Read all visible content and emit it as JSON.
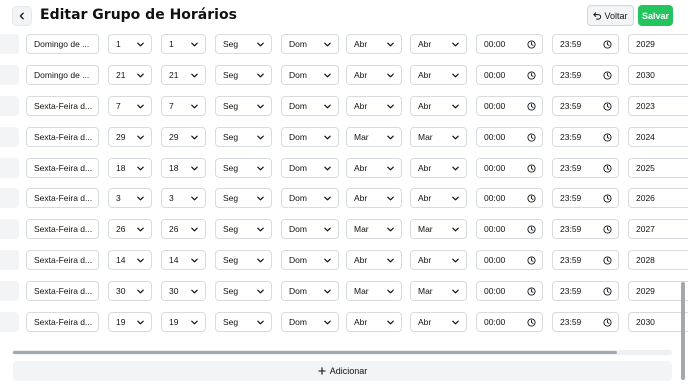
{
  "header": {
    "title": "Editar Grupo de Horários",
    "voltar_label": "Voltar",
    "salvar_label": "Salvar",
    "salvar_color": "#22c55e"
  },
  "rows": [
    {
      "name": "Domingo de ...",
      "day_start": "1",
      "day_end": "1",
      "weekday_start": "Seg",
      "weekday_end": "Dom",
      "month_start": "Abr",
      "month_end": "Abr",
      "time_start": "00:00",
      "time_end": "23:59",
      "year": "2029"
    },
    {
      "name": "Domingo de ...",
      "day_start": "21",
      "day_end": "21",
      "weekday_start": "Seg",
      "weekday_end": "Dom",
      "month_start": "Abr",
      "month_end": "Abr",
      "time_start": "00:00",
      "time_end": "23:59",
      "year": "2030"
    },
    {
      "name": "Sexta-Feira d...",
      "day_start": "7",
      "day_end": "7",
      "weekday_start": "Seg",
      "weekday_end": "Dom",
      "month_start": "Abr",
      "month_end": "Abr",
      "time_start": "00:00",
      "time_end": "23:59",
      "year": "2023"
    },
    {
      "name": "Sexta-Feira d...",
      "day_start": "29",
      "day_end": "29",
      "weekday_start": "Seg",
      "weekday_end": "Dom",
      "month_start": "Mar",
      "month_end": "Mar",
      "time_start": "00:00",
      "time_end": "23:59",
      "year": "2024"
    },
    {
      "name": "Sexta-Feira d...",
      "day_start": "18",
      "day_end": "18",
      "weekday_start": "Seg",
      "weekday_end": "Dom",
      "month_start": "Abr",
      "month_end": "Abr",
      "time_start": "00:00",
      "time_end": "23:59",
      "year": "2025"
    },
    {
      "name": "Sexta-Feira d...",
      "day_start": "3",
      "day_end": "3",
      "weekday_start": "Seg",
      "weekday_end": "Dom",
      "month_start": "Abr",
      "month_end": "Abr",
      "time_start": "00:00",
      "time_end": "23:59",
      "year": "2026"
    },
    {
      "name": "Sexta-Feira d...",
      "day_start": "26",
      "day_end": "26",
      "weekday_start": "Seg",
      "weekday_end": "Dom",
      "month_start": "Mar",
      "month_end": "Mar",
      "time_start": "00:00",
      "time_end": "23:59",
      "year": "2027"
    },
    {
      "name": "Sexta-Feira d...",
      "day_start": "14",
      "day_end": "14",
      "weekday_start": "Seg",
      "weekday_end": "Dom",
      "month_start": "Abr",
      "month_end": "Abr",
      "time_start": "00:00",
      "time_end": "23:59",
      "year": "2028"
    },
    {
      "name": "Sexta-Feira d...",
      "day_start": "30",
      "day_end": "30",
      "weekday_start": "Seg",
      "weekday_end": "Dom",
      "month_start": "Mar",
      "month_end": "Mar",
      "time_start": "00:00",
      "time_end": "23:59",
      "year": "2029"
    },
    {
      "name": "Sexta-Feira d...",
      "day_start": "19",
      "day_end": "19",
      "weekday_start": "Seg",
      "weekday_end": "Dom",
      "month_start": "Abr",
      "month_end": "Abr",
      "time_start": "00:00",
      "time_end": "23:59",
      "year": "2030"
    }
  ],
  "footer": {
    "add_label": "Adicionar"
  },
  "icons": {
    "back": "chevron-left-icon",
    "voltar": "undo-arrow-icon",
    "select": "chevron-down-icon",
    "time": "clock-icon",
    "add": "plus-icon"
  }
}
